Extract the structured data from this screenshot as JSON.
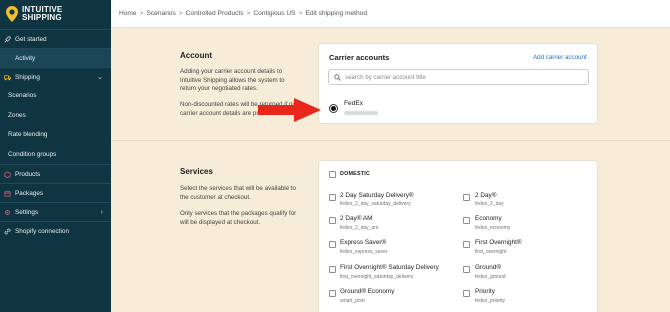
{
  "brand": {
    "name_line1": "INTUITIVE",
    "name_line2": "SHIPPING",
    "accent": "#f2c02c"
  },
  "sidebar": {
    "items": [
      {
        "label": "Get started",
        "icon": "rocket-icon"
      },
      {
        "label": "Activity",
        "icon": "none"
      },
      {
        "label": "Shipping",
        "icon": "truck-icon",
        "chevron": "⌄"
      },
      {
        "label": "Scenarios"
      },
      {
        "label": "Zones"
      },
      {
        "label": "Rate blending"
      },
      {
        "label": "Condition groups"
      },
      {
        "label": "Products",
        "icon": "box-icon"
      },
      {
        "label": "Packages",
        "icon": "package-icon"
      },
      {
        "label": "Settings",
        "icon": "gear-icon",
        "chevron": "›"
      },
      {
        "label": "Shopify connection",
        "icon": "link-icon"
      }
    ]
  },
  "breadcrumb": [
    "Home",
    "Scenarios",
    "Controlled Products",
    "Contigious US",
    "Edit shipping method"
  ],
  "breadcrumb_sep": ">",
  "account": {
    "title": "Account",
    "desc1": "Adding your carrier account details to Intuitive Shipping allows the system to return your negotiated rates.",
    "desc2": "Non-discounted rates will be returned if no carrier account details are provided."
  },
  "carrier_accounts": {
    "title": "Carrier accounts",
    "add_link": "Add carrier account",
    "search_placeholder": "search by carrier account title",
    "selected_carrier": "FedEx"
  },
  "services": {
    "title": "Services",
    "desc1": "Select the services that will be available to the customer at checkout.",
    "desc2": "Only services that the packages qualify for will be displayed at checkout.",
    "group": "DOMESTIC",
    "left": [
      {
        "label": "2 Day Saturday Delivery®",
        "code": "fedex_2_day_saturday_delivery"
      },
      {
        "label": "2 Day® AM",
        "code": "fedex_2_day_am"
      },
      {
        "label": "Express Saver®",
        "code": "fedex_express_saver"
      },
      {
        "label": "First Overnight® Saturday Delivery",
        "code": "first_overnight_saturday_delivery"
      },
      {
        "label": "Ground® Economy",
        "code": "smart_post"
      }
    ],
    "right": [
      {
        "label": "2 Day®",
        "code": "fedex_2_day"
      },
      {
        "label": "Economy",
        "code": "fedex_economy"
      },
      {
        "label": "First Overnight®",
        "code": "first_overnight"
      },
      {
        "label": "Ground®",
        "code": "fedex_ground"
      },
      {
        "label": "Priority",
        "code": "fedex_priority"
      }
    ]
  },
  "colors": {
    "sidebar_bg": "#0f3442",
    "page_bg": "#f7ecd8",
    "link": "#2c6ecb",
    "arrow": "#e8261c"
  }
}
